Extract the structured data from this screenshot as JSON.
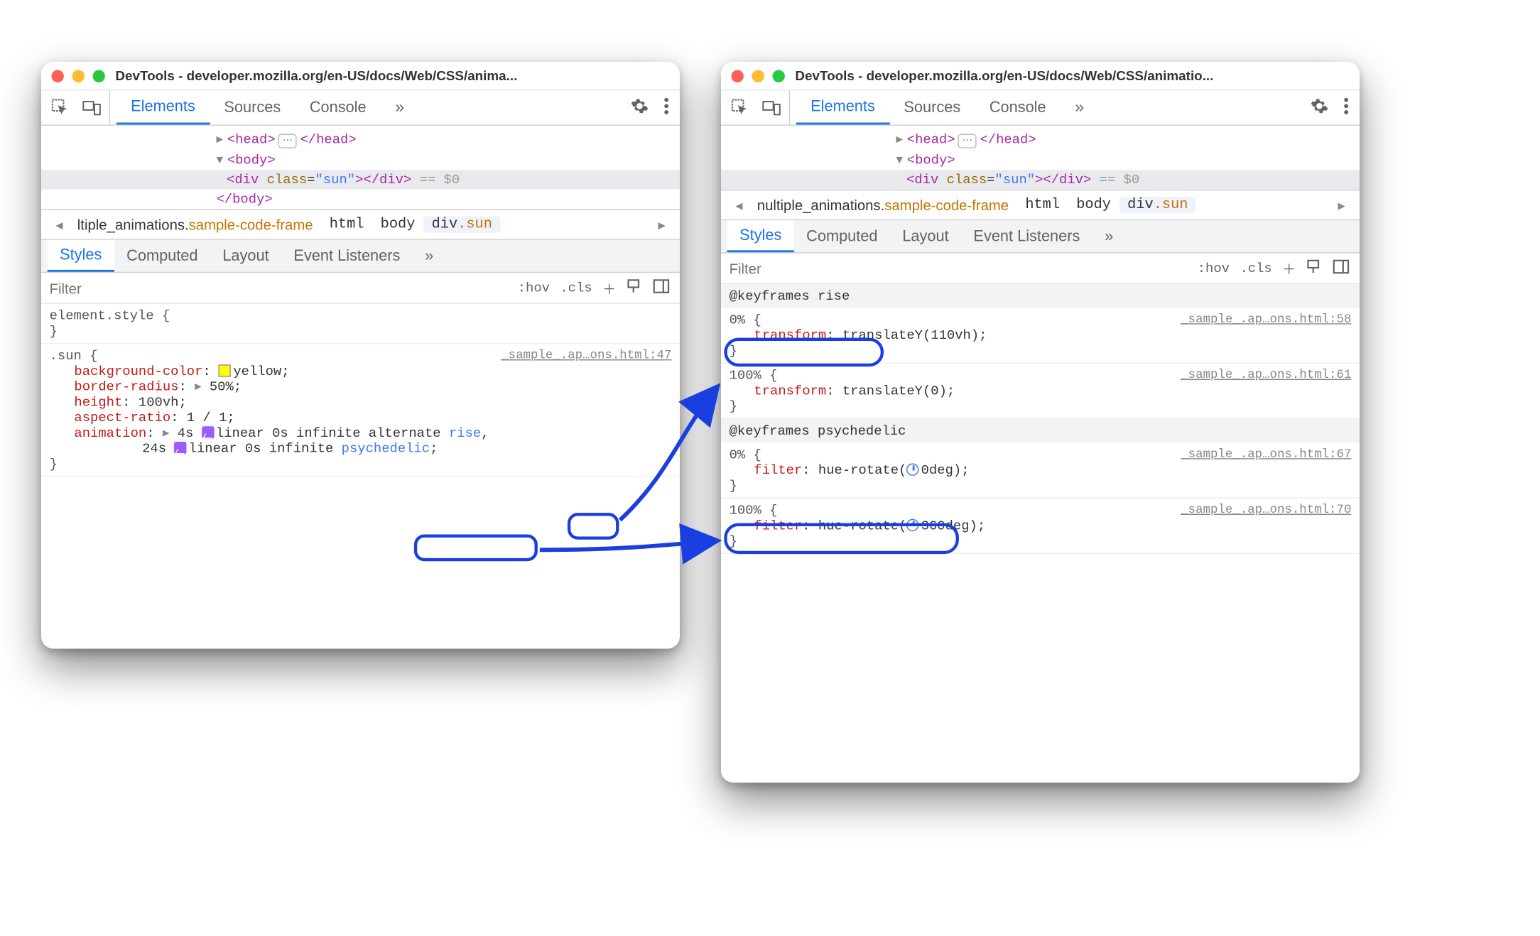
{
  "title_left": "DevTools - developer.mozilla.org/en-US/docs/Web/CSS/anima...",
  "title_right": "DevTools - developer.mozilla.org/en-US/docs/Web/CSS/animatio...",
  "tabs": {
    "elements": "Elements",
    "sources": "Sources",
    "console": "Console"
  },
  "dom": {
    "head_open": "<head>",
    "head_close": "</head>",
    "body_open": "<body>",
    "body_close": "</body>",
    "div_open_tag": "div",
    "div_attr_name": "class",
    "div_attr_val": "sun",
    "div_close": "</div>",
    "eqdollar": "== $0"
  },
  "crumbs_left": {
    "a": "ltiple_animations.",
    "b": "sample-code-frame",
    "c": "html",
    "d": "body",
    "e": "div.sun"
  },
  "crumbs_right": {
    "a": "nultiple_animations.",
    "b": "sample-code-frame",
    "c": "html",
    "d": "body",
    "e": "div.sun"
  },
  "subtabs": {
    "styles": "Styles",
    "computed": "Computed",
    "layout": "Layout",
    "events": "Event Listeners"
  },
  "filter": {
    "placeholder": "Filter",
    "hov": ":hov",
    "cls": ".cls"
  },
  "rule_element_style": "element.style {",
  "rule_sun": {
    "selector": ".sun {",
    "src": "_sample_.ap…ons.html:47",
    "p1n": "background-color",
    "p1v": "yellow",
    "p2n": "border-radius",
    "p2v": "50%",
    "p3n": "height",
    "p3v": "100vh",
    "p4n": "aspect-ratio",
    "p4v": "1 / 1",
    "p5n": "animation",
    "p5v_a": "4s",
    "p5v_b": "linear 0s infinite alternate",
    "p5v_rise": "rise",
    "p5v_c": "24s",
    "p5v_d": "linear 0s infinite",
    "p5v_psy": "psychedelic"
  },
  "kf_rise": {
    "header": "@keyframes rise",
    "s0_sel": "0% {",
    "s0_src": "_sample_.ap…ons.html:58",
    "s0_pn": "transform",
    "s0_pv": "translateY(110vh)",
    "s1_sel": "100% {",
    "s1_src": "_sample_.ap…ons.html:61",
    "s1_pn": "transform",
    "s1_pv": "translateY(0)"
  },
  "kf_psy": {
    "header": "@keyframes psychedelic",
    "s0_sel": "0% {",
    "s0_src": "_sample_.ap…ons.html:67",
    "s0_pn": "filter",
    "s0_pv": "hue-rotate(",
    "s0_deg": "0deg)",
    "s1_sel": "100% {",
    "s1_src": "_sample_.ap…ons.html:70",
    "s1_pn": "filter",
    "s1_pv": "hue-rotate(",
    "s1_deg": "360deg)"
  },
  "glyph_more": "»",
  "glyph_plus": "＋",
  "glyph_right": "▸",
  "glyph_left": "◂"
}
